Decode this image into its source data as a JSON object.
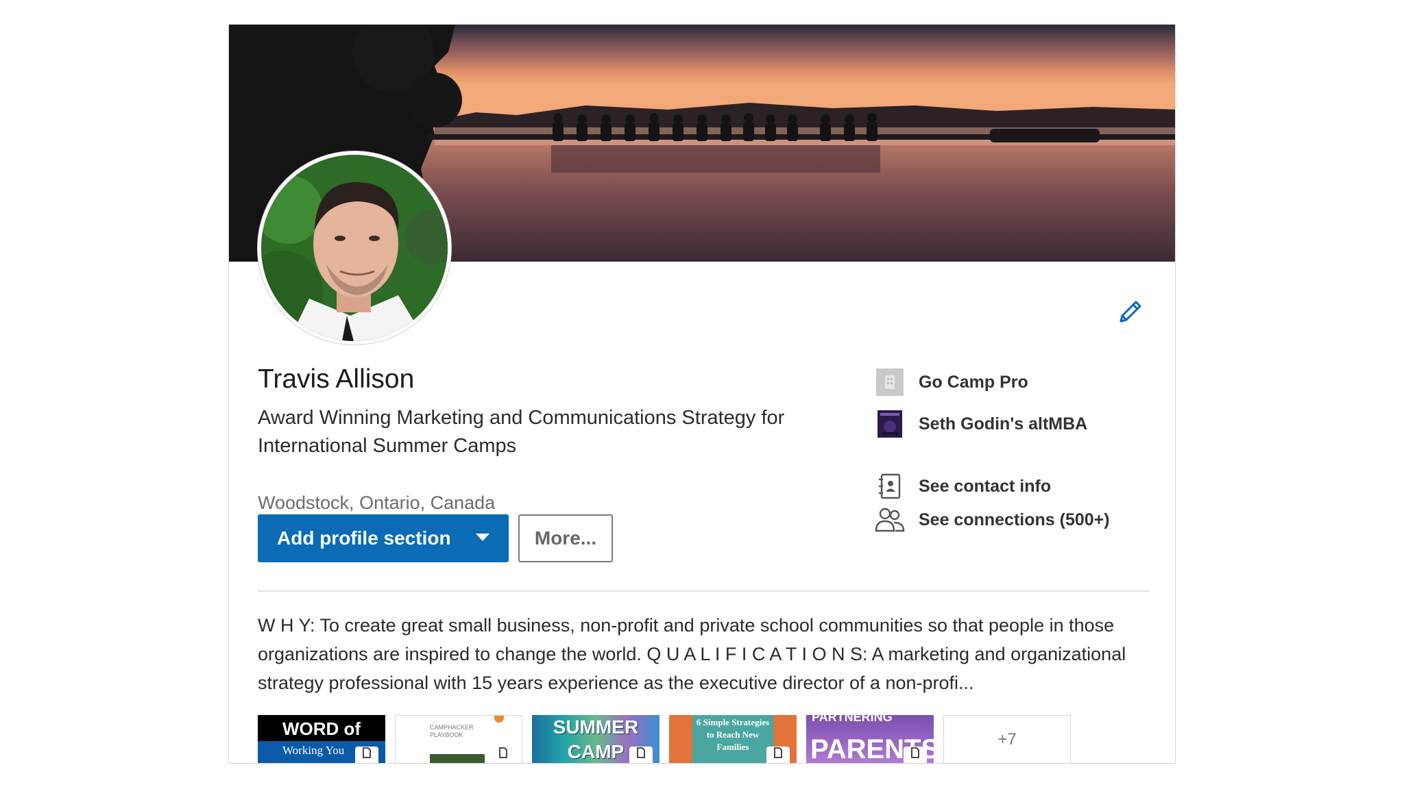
{
  "profile": {
    "name": "Travis Allison",
    "headline": "Award Winning Marketing and Communications Strategy for International Summer Camps",
    "location": "Woodstock, Ontario, Canada",
    "summary": "W H Y: To create great small business, non-profit and private school communities so that people in those organizations are inspired to change the world. Q U A L I F I C A T I O N S: A marketing and organizational strategy professional with 15 years experience as the executive director of a non-profi..."
  },
  "actions": {
    "add_section": "Add profile section",
    "more": "More..."
  },
  "sidebar": [
    {
      "label": "Go Camp Pro",
      "icon": "company-logo-icon"
    },
    {
      "label": "Seth Godin's altMBA",
      "icon": "school-logo-icon"
    },
    {
      "label": "See contact info",
      "icon": "contact-card-icon"
    },
    {
      "label": "See connections (500+)",
      "icon": "connections-icon"
    }
  ],
  "media": {
    "items": [
      {
        "title": "WORD of MOUTH",
        "subtitle": "Working You"
      },
      {
        "title": "CAMPHACKER PLAYBOOK",
        "subtitle": ""
      },
      {
        "title": "SUMMER CAMP",
        "subtitle": ""
      },
      {
        "title": "6 Simple Strategies to Reach New Families",
        "subtitle": ""
      },
      {
        "title": "PARENTS",
        "subtitle": "PARTNERING"
      }
    ],
    "more_count": "+7"
  },
  "colors": {
    "primary": "#0b6bb5",
    "edit_icon": "#0a66c2"
  }
}
